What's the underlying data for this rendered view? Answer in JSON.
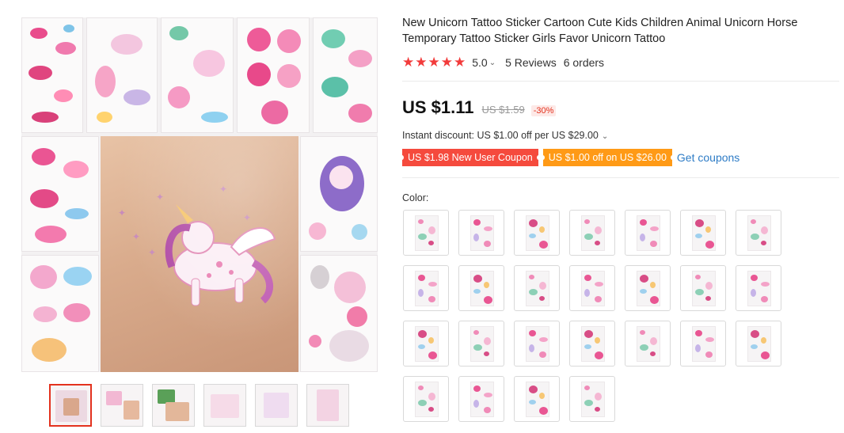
{
  "product": {
    "title": "New Unicorn Tattoo Sticker Cartoon Cute Kids Children Animal Unicorn Horse Temporary Tattoo Sticker Girls Favor Unicorn Tattoo",
    "rating": "5.0",
    "star_count": 5,
    "reviews": "5 Reviews",
    "orders": "6 orders"
  },
  "pricing": {
    "price": "US $1.11",
    "original_price": "US $1.59",
    "discount": "-30%",
    "instant_discount": "Instant discount: US $1.00 off per US $29.00"
  },
  "coupons": {
    "new_user": "US $1.98 New User Coupon",
    "store": "US $1.00 off on US $26.00",
    "get_coupons": "Get coupons"
  },
  "color": {
    "label": "Color:",
    "swatch_count": 25
  },
  "gallery": {
    "thumbnail_count": 6,
    "active_thumbnail": 1
  },
  "colors": {
    "star": "#f23b3b",
    "coupon_red": "#f54a3d",
    "coupon_orange": "#ff9a16",
    "link": "#2e7cc6",
    "discount_text": "#e3321e"
  }
}
